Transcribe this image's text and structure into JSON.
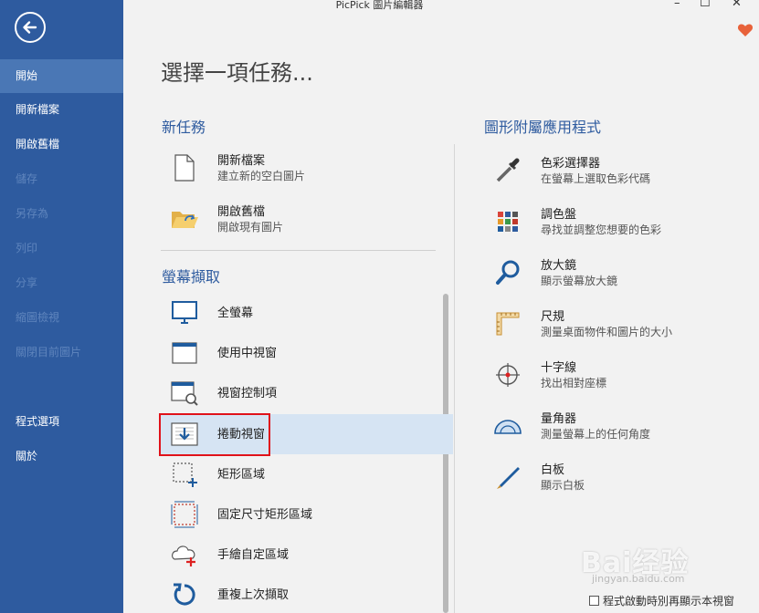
{
  "window": {
    "title": "PicPick 圖片編輯器",
    "min": "–",
    "max": "☐",
    "close": "✕"
  },
  "sidebar": {
    "items": [
      {
        "label": "開始",
        "state": "active"
      },
      {
        "label": "開新檔案",
        "state": "enabled"
      },
      {
        "label": "開啟舊檔",
        "state": "enabled"
      },
      {
        "label": "儲存",
        "state": "disabled"
      },
      {
        "label": "另存為",
        "state": "disabled"
      },
      {
        "label": "列印",
        "state": "disabled"
      },
      {
        "label": "分享",
        "state": "disabled"
      },
      {
        "label": "縮圖檢視",
        "state": "disabled"
      },
      {
        "label": "關閉目前圖片",
        "state": "disabled"
      },
      {
        "label": "程式選項",
        "state": "enabled"
      },
      {
        "label": "關於",
        "state": "enabled"
      }
    ]
  },
  "main": {
    "heading": "選擇一項任務...",
    "new_task": {
      "title": "新任務",
      "items": [
        {
          "label": "開新檔案",
          "desc": "建立新的空白圖片",
          "icon": "new-file-icon"
        },
        {
          "label": "開啟舊檔",
          "desc": "開啟現有圖片",
          "icon": "open-folder-icon"
        }
      ]
    },
    "capture": {
      "title": "螢幕擷取",
      "items": [
        {
          "label": "全螢幕",
          "icon": "monitor-icon"
        },
        {
          "label": "使用中視窗",
          "icon": "window-icon"
        },
        {
          "label": "視窗控制項",
          "icon": "window-control-icon"
        },
        {
          "label": "捲動視窗",
          "icon": "scroll-window-icon",
          "selected": true
        },
        {
          "label": "矩形區域",
          "icon": "rectangle-region-icon"
        },
        {
          "label": "固定尺寸矩形區域",
          "icon": "fixed-rectangle-icon"
        },
        {
          "label": "手繪自定區域",
          "icon": "freehand-region-icon"
        },
        {
          "label": "重複上次擷取",
          "icon": "repeat-capture-icon"
        }
      ]
    },
    "tools": {
      "title": "圖形附屬應用程式",
      "items": [
        {
          "label": "色彩選擇器",
          "desc": "在螢幕上選取色彩代碼",
          "icon": "eyedropper-icon"
        },
        {
          "label": "調色盤",
          "desc": "尋找並調整您想要的色彩",
          "icon": "palette-icon"
        },
        {
          "label": "放大鏡",
          "desc": "顯示螢幕放大鏡",
          "icon": "magnifier-icon"
        },
        {
          "label": "尺規",
          "desc": "測量桌面物件和圖片的大小",
          "icon": "ruler-icon"
        },
        {
          "label": "十字線",
          "desc": "找出相對座標",
          "icon": "crosshair-icon"
        },
        {
          "label": "量角器",
          "desc": "測量螢幕上的任何角度",
          "icon": "protractor-icon"
        },
        {
          "label": "白板",
          "desc": "顯示白板",
          "icon": "pen-icon"
        }
      ]
    }
  },
  "footer": {
    "startup_label": "程式啟動時別再顯示本視窗",
    "startup_checked": false
  },
  "watermark": {
    "text": "Bai经验",
    "sub": "jingyan.baidu.com"
  },
  "colors": {
    "sidebar": "#2e5b9f",
    "active": "#4a77b5",
    "accent": "#2e5b9f",
    "highlight": "#d6e4f3",
    "red_outline": "#e0121a",
    "heart": "#e8623a"
  }
}
